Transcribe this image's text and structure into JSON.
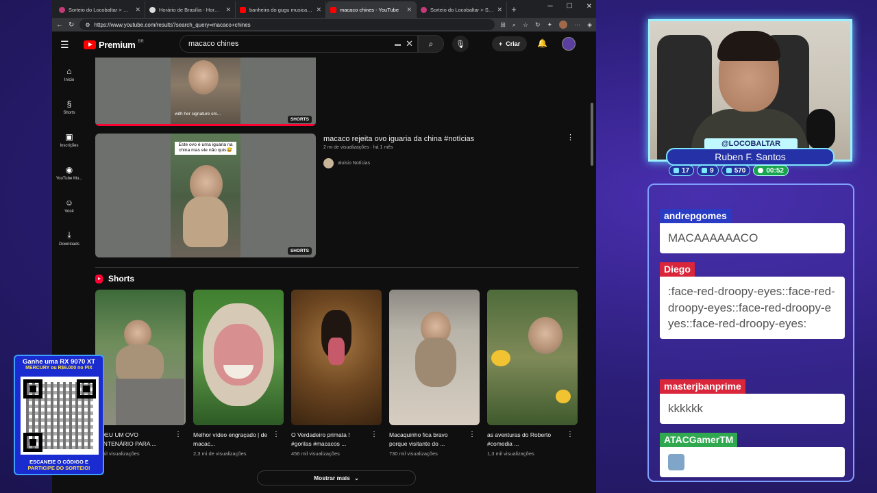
{
  "browser": {
    "tabs": [
      {
        "title": "Sorteio do Locobaltar > Dado...",
        "color": "#c43b7a",
        "active": false
      },
      {
        "title": "Horário de Brasília - Hora Cert...",
        "color": "#dddddd",
        "active": false
      },
      {
        "title": "banheira do gugu musica - Yo...",
        "color": "#ff0000",
        "active": false
      },
      {
        "title": "macaco chines - YouTube",
        "color": "#ff0000",
        "active": true
      },
      {
        "title": "Sorteio do Locobaltar > Sorte...",
        "color": "#c43b7a",
        "active": false
      }
    ],
    "url": "https://www.youtube.com/results?search_query=macaco+chines"
  },
  "youtube": {
    "logo": "Premium",
    "logo_region": "BR",
    "search_value": "macaco chines",
    "create_label": "Criar",
    "sidebar": [
      {
        "label": "Início",
        "icon": "⌂"
      },
      {
        "label": "Shorts",
        "icon": "§"
      },
      {
        "label": "Inscrições",
        "icon": "▣"
      },
      {
        "label": "YouTube Mu...",
        "icon": "◉"
      },
      {
        "label": "Você",
        "icon": "☺"
      },
      {
        "label": "Downloads",
        "icon": "⤓"
      }
    ],
    "top_video": {
      "badge": "SHORTS",
      "caption": "with her signature sm..."
    },
    "video": {
      "title": "macaco rejeita ovo iguaria da china #notícias",
      "meta": "2 mi de visualizações · há 1 mês",
      "channel": "aloisio Notícias",
      "caption": "Este ovo é uma iguaria na china mas ele não quis😅",
      "badge": "SHORTS"
    },
    "shorts_heading": "Shorts",
    "shorts": [
      {
        "title": "E DEU UM OVO CENTENÁRIO PARA ...",
        "views": "... mil visualizações"
      },
      {
        "title": "Melhor vídeo engraçado | de macac...",
        "views": "2,3 mi de visualizações"
      },
      {
        "title": "O Verdadeiro primata ! #gorilas #macacos ...",
        "views": "456 mil visualizações"
      },
      {
        "title": "Macaquinho fica bravo porque visitante do ...",
        "views": "730 mil visualizações"
      },
      {
        "title": "as aventuras do Roberto #comedia ...",
        "views": "1,3 mil visualizações"
      }
    ],
    "more_label": "Mostrar mais"
  },
  "stream": {
    "handle": "@LOCOBALTAR",
    "name": "Ruben F. Santos",
    "stats": [
      "17",
      "9",
      "570",
      "00:52"
    ],
    "chat": [
      {
        "user": "andrepgomes",
        "color": "#2a3bc4",
        "text": "MACAAAAAACO"
      },
      {
        "user": "Diego",
        "color": "#d9263a",
        "text": ":face-red-droopy-eyes::face-red-droopy-eyes::face-red-droopy-eyes::face-red-droopy-eyes:"
      },
      {
        "user": "masterjbanprime",
        "color": "#d9263a",
        "text": "kkkkkk"
      },
      {
        "user": "ATACGamerTM",
        "color": "#2fa84f",
        "text": ""
      }
    ],
    "giveaway": {
      "line1": "Ganhe uma RX 9070 XT",
      "line2": "MERCURY ou R$6.000 no PIX",
      "line3": "ESCANEIE O CÓDIGO E",
      "line4": "PARTICIPE DO SORTEIO!"
    }
  }
}
